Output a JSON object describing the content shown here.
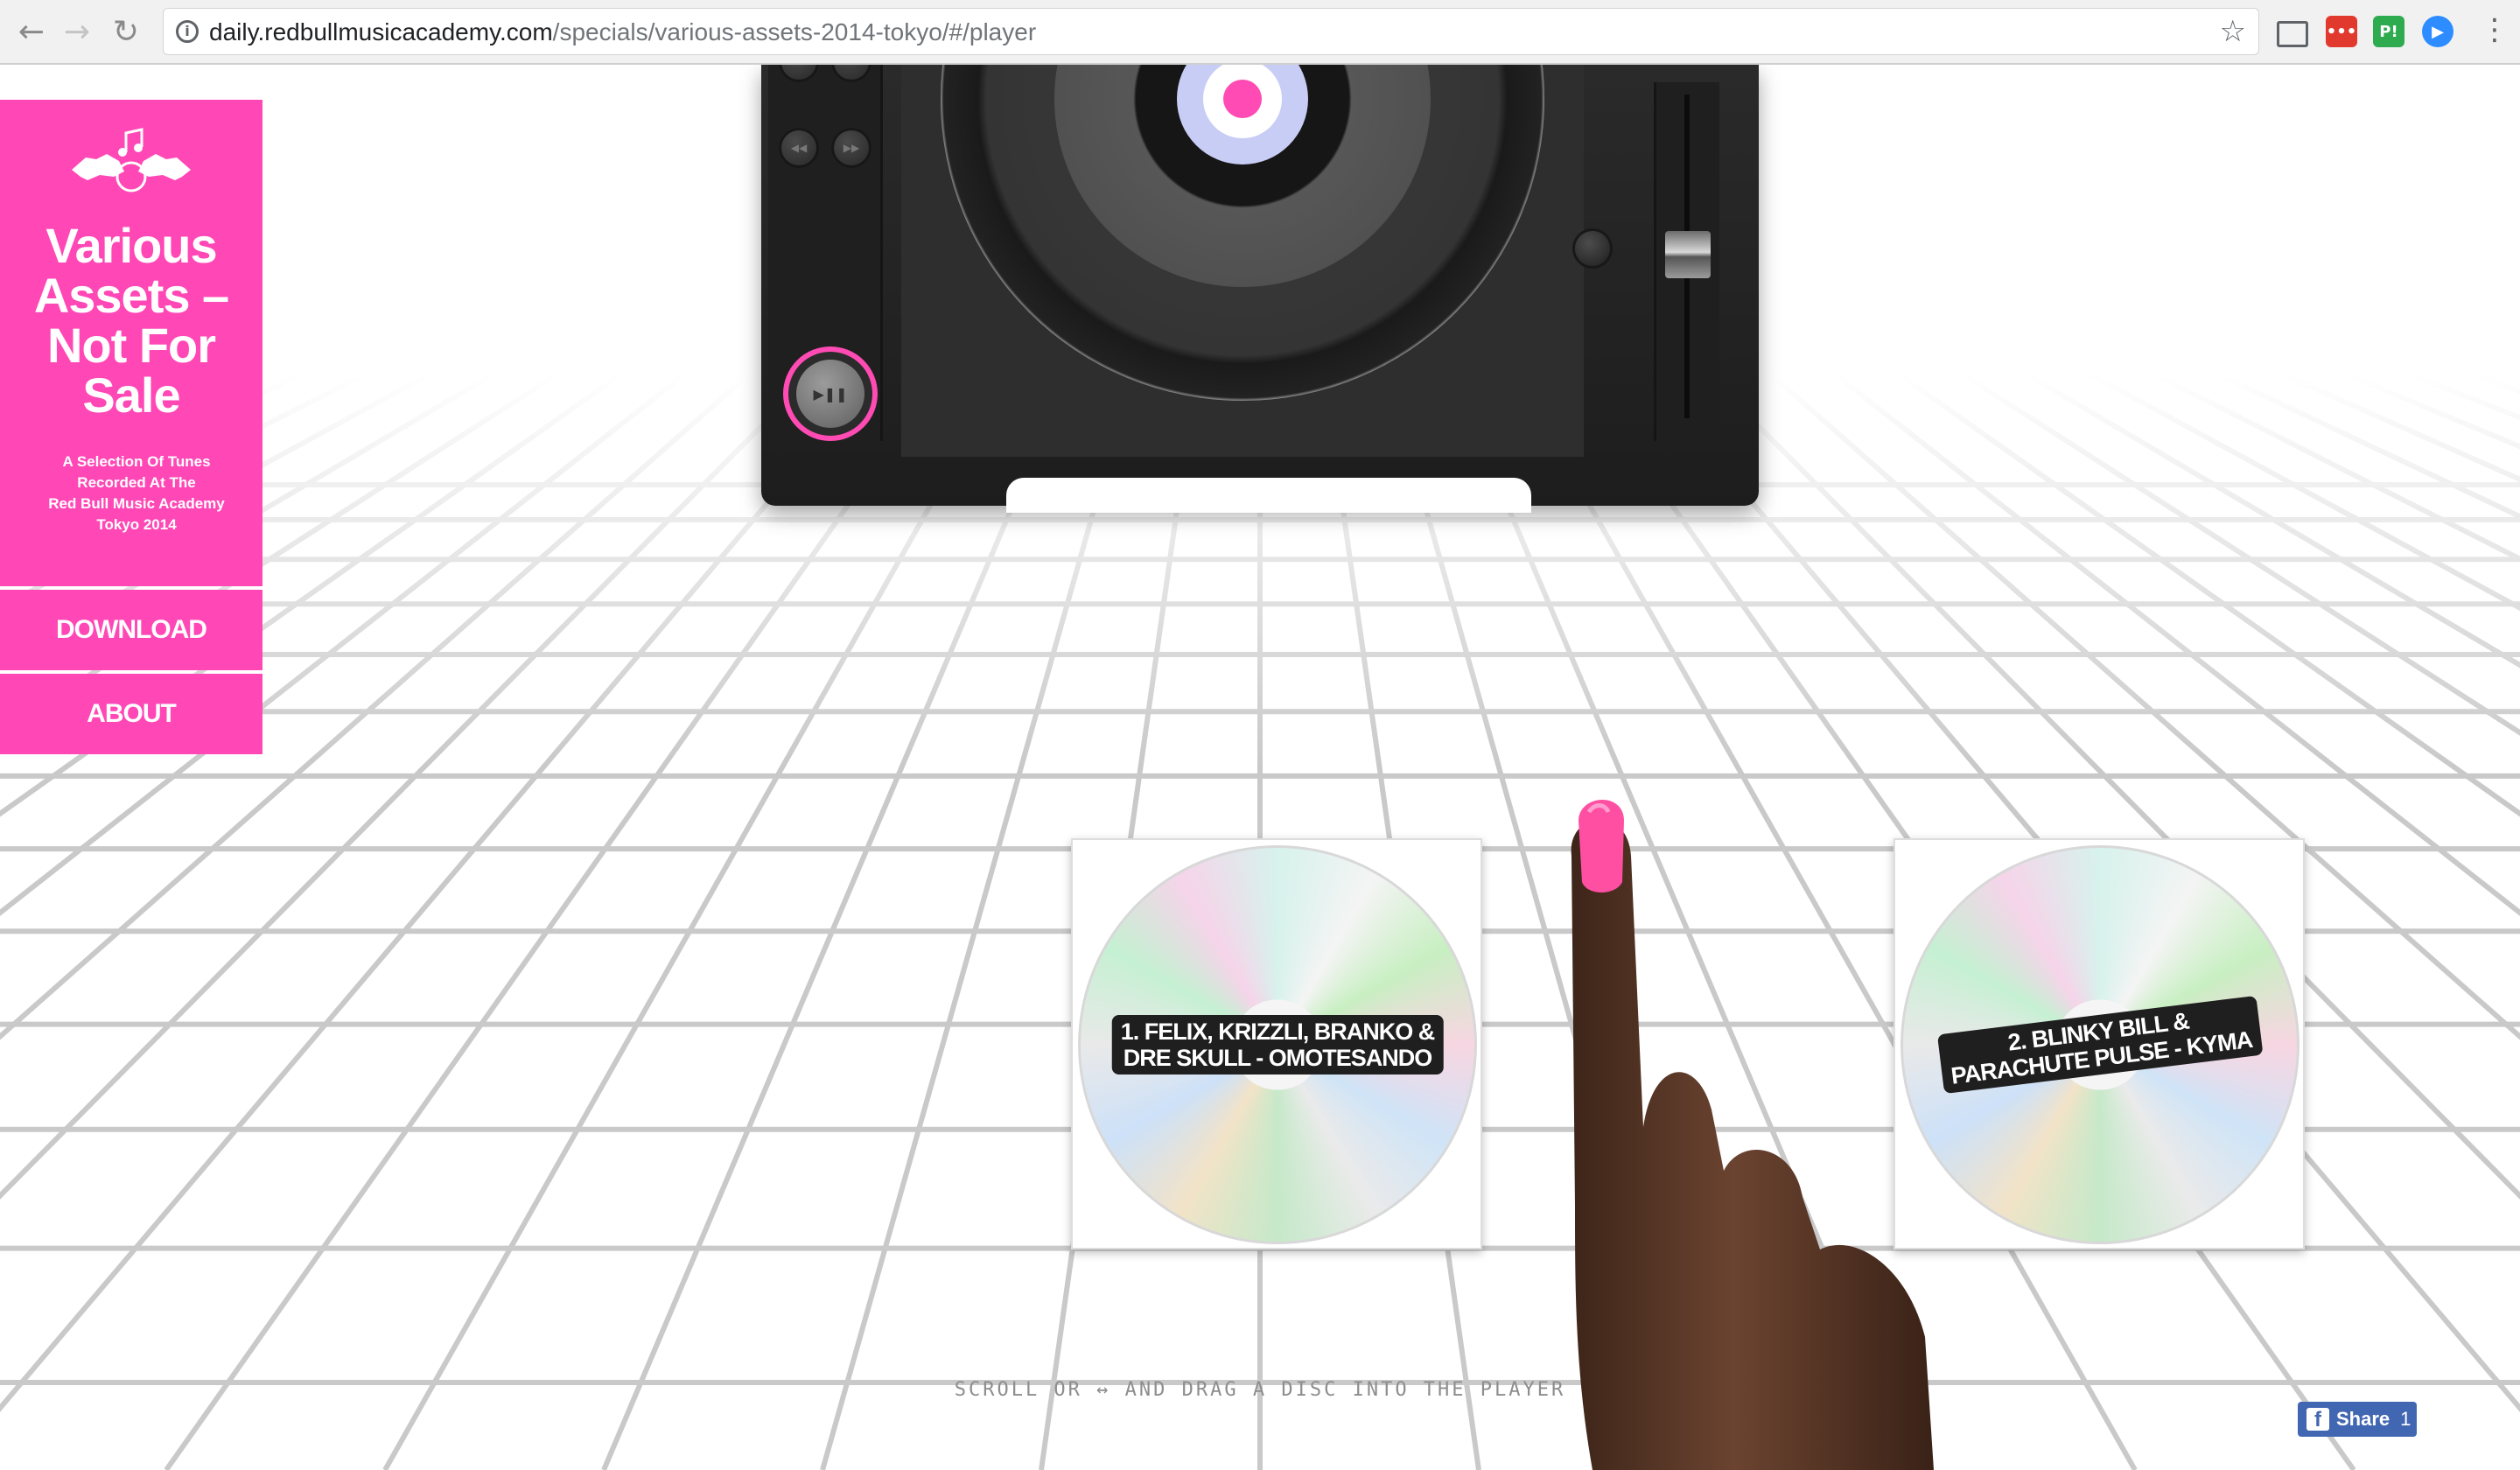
{
  "browser": {
    "url_host": "daily.redbullmusicacademy.com",
    "url_path": "/specials/various-assets-2014-tokyo/#/player"
  },
  "colors": {
    "brand_pink": "#ff47b6",
    "share_blue": "#4267b2"
  },
  "sidebar": {
    "title": "Various Assets – Not For Sale",
    "subtitle_lines": [
      "A Selection Of Tunes",
      "Recorded At The",
      "Red Bull Music Academy",
      "Tokyo 2014"
    ],
    "download_label": "Download",
    "about_label": "About"
  },
  "player": {
    "play_pause_icon": "play-pause-icon",
    "rewind_icon": "rewind-icon",
    "forward_icon": "fast-forward-icon"
  },
  "discs": [
    {
      "line1": "1. Felix, Krizzli, Branko &",
      "line2": "Dre Skull - Omotesando"
    },
    {
      "line1": "2. Blinky Bill &",
      "line2": "Parachute Pulse - Kyma"
    }
  ],
  "hint": "Scroll or ↔ and drag a disc into the player",
  "share": {
    "label": "Share",
    "count": "1"
  }
}
